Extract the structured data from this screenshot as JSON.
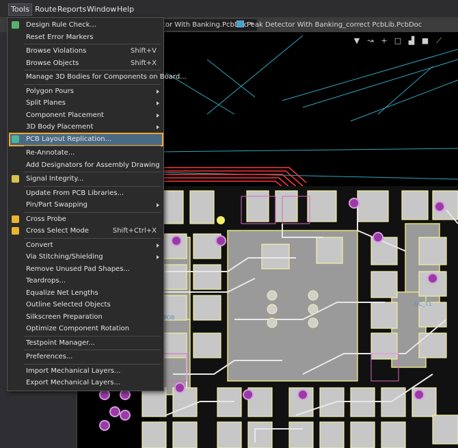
{
  "menubar": {
    "items": [
      "Tools",
      "Route",
      "Reports",
      "Window",
      "Help"
    ]
  },
  "tabs": [
    {
      "label": "tor With Banking.PcbDoc *"
    },
    {
      "label": "Peak Detector With Banking_correct PcbLib.PcbDoc"
    }
  ],
  "canvas_tools": [
    "filter",
    "route",
    "add",
    "select",
    "chart",
    "component",
    "draw"
  ],
  "menu": {
    "items": [
      {
        "label": "Design Rule Check...",
        "shortcut": "",
        "submenu": false,
        "icon": "drc-icon"
      },
      {
        "label": "Reset Error Markers",
        "shortcut": "",
        "submenu": false
      },
      {
        "label": "Browse Violations",
        "shortcut": "Shift+V",
        "submenu": false
      },
      {
        "label": "Browse Objects",
        "shortcut": "Shift+X",
        "submenu": false
      },
      {
        "label": "Manage 3D Bodies for Components on Board...",
        "shortcut": "",
        "submenu": false
      },
      {
        "label": "Polygon Pours",
        "shortcut": "",
        "submenu": true
      },
      {
        "label": "Split Planes",
        "shortcut": "",
        "submenu": true
      },
      {
        "label": "Component Placement",
        "shortcut": "",
        "submenu": true
      },
      {
        "label": "3D Body Placement",
        "shortcut": "",
        "submenu": true
      },
      {
        "label": "PCB Layout Replication...",
        "shortcut": "",
        "submenu": false,
        "icon": "replication-icon"
      },
      {
        "label": "Re-Annotate...",
        "shortcut": "",
        "submenu": false
      },
      {
        "label": "Add Designators for Assembly Drawing",
        "shortcut": "",
        "submenu": false
      },
      {
        "label": "Signal Integrity...",
        "shortcut": "",
        "submenu": false,
        "icon": "signal-integrity-icon"
      },
      {
        "label": "Update From PCB Libraries...",
        "shortcut": "",
        "submenu": false
      },
      {
        "label": "Pin/Part Swapping",
        "shortcut": "",
        "submenu": true
      },
      {
        "label": "Cross Probe",
        "shortcut": "",
        "submenu": false,
        "icon": "cross-probe-icon"
      },
      {
        "label": "Cross Select Mode",
        "shortcut": "Shift+Ctrl+X",
        "submenu": false,
        "icon": "cross-select-icon"
      },
      {
        "label": "Convert",
        "shortcut": "",
        "submenu": true
      },
      {
        "label": "Via Stitching/Shielding",
        "shortcut": "",
        "submenu": true
      },
      {
        "label": "Remove Unused Pad Shapes...",
        "shortcut": "",
        "submenu": false
      },
      {
        "label": "Teardrops...",
        "shortcut": "",
        "submenu": false
      },
      {
        "label": "Equalize Net Lengths",
        "shortcut": "",
        "submenu": false
      },
      {
        "label": "Outline Selected Objects",
        "shortcut": "",
        "submenu": false
      },
      {
        "label": "Silkscreen Preparation",
        "shortcut": "",
        "submenu": false
      },
      {
        "label": "Optimize Component Rotation",
        "shortcut": "",
        "submenu": false
      },
      {
        "label": "Testpoint Manager...",
        "shortcut": "",
        "submenu": false
      },
      {
        "label": "Preferences...",
        "shortcut": "",
        "submenu": false
      },
      {
        "label": "Import Mechanical Layers...",
        "shortcut": "",
        "submenu": false
      },
      {
        "label": "Export Mechanical Layers...",
        "shortcut": "",
        "submenu": false
      }
    ],
    "highlighted_index": 9
  },
  "canvas_text": [
    "NC_T1",
    "POB"
  ],
  "colors": {
    "highlight": "#4a6984",
    "highlight_border": "#f0a830",
    "pad": "#bdbdbd",
    "silk": "#f3f0a0",
    "trace_red": "#ff3b3b",
    "trace_cyan": "#2fb3c8"
  }
}
